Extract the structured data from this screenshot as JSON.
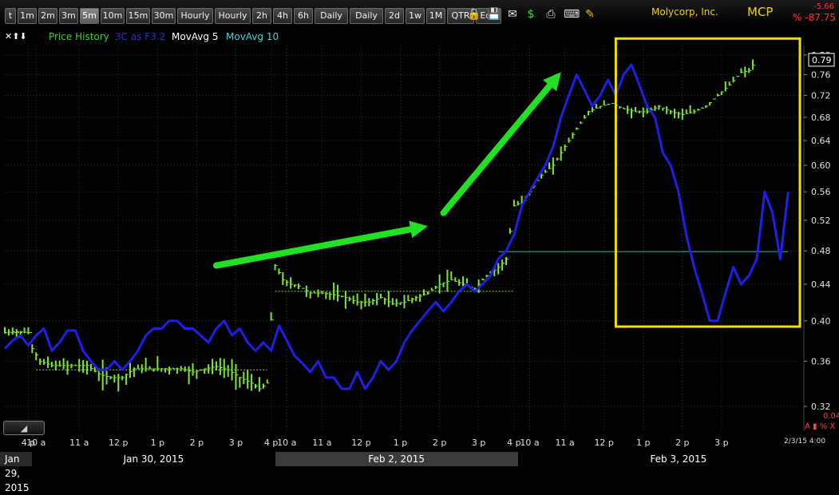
{
  "toolbar": {
    "timeframes": [
      "t",
      "1m",
      "2m",
      "3m",
      "5m",
      "10m",
      "15m",
      "30m",
      "Hourly",
      "Hourly",
      "2h",
      "4h",
      "6h",
      "Daily",
      "Daily",
      "2d",
      "1w",
      "1M",
      "QTR",
      "Edit"
    ],
    "active": "5m",
    "icons": [
      "lock-icon",
      "save-icon",
      "mail-icon",
      "dollar-icon",
      "print-icon",
      "keyboard-icon",
      "pencil-icon"
    ]
  },
  "header": {
    "company": "Molycorp, Inc.",
    "symbol": "MCP",
    "change": "-5.66",
    "change_pct": "% -87.75"
  },
  "legend": {
    "arrows": "✕⬆⬇",
    "items": [
      {
        "label": "Price History",
        "color": "#39d33a"
      },
      {
        "label": "3C as F3.2",
        "color": "#2b2bd9"
      },
      {
        "label": "MovAvg 5",
        "color": "#ffffff"
      },
      {
        "label": "MovAvg 10",
        "color": "#4ad3d3"
      }
    ]
  },
  "colors": {
    "price": "#7ee830",
    "indicator": "#1f1fe8",
    "arrow": "#22e022",
    "box": "#f0e000",
    "ref_line": "#3aa6a6",
    "grid": "#2a3a2a"
  },
  "chart_data": {
    "type": "line",
    "price_scale": {
      "ylim": [
        0.3,
        0.82
      ],
      "ticks": [
        "0.80",
        "0.76",
        "0.72",
        "0.68",
        "0.64",
        "0.60",
        "0.56",
        "0.52",
        "0.48",
        "0.44",
        "0.40",
        "0.36",
        "0.32"
      ],
      "last_value": "0.79"
    },
    "x_tick_labels": [
      "4 p",
      "10 a",
      "11 a",
      "12 p",
      "1 p",
      "2 p",
      "3 p",
      "4 p",
      "10 a",
      "11 a",
      "12 p",
      "1 p",
      "2 p",
      "3 p",
      "4 p",
      "10 a",
      "11 a",
      "12 p",
      "1 p",
      "2 p",
      "3 p"
    ],
    "x_tick_times": [
      6,
      8,
      19,
      29,
      39,
      49,
      59,
      68,
      72,
      81,
      91,
      101,
      111,
      121,
      130,
      134,
      143,
      153,
      163,
      173,
      183
    ],
    "date_labels": [
      "Jan 29, 2015",
      "Jan 30, 2015",
      "Feb 2, 2015",
      "Feb 3, 2015"
    ],
    "session_breaks": [
      7,
      69,
      131
    ],
    "series": [
      {
        "name": "Price History",
        "style": "ohlc-bars",
        "points": [
          [
            0,
            0.388
          ],
          [
            3,
            0.389
          ],
          [
            6,
            0.388
          ],
          [
            7,
            0.372
          ],
          [
            9,
            0.36
          ],
          [
            12,
            0.356
          ],
          [
            15,
            0.356
          ],
          [
            18,
            0.356
          ],
          [
            21,
            0.356
          ],
          [
            24,
            0.348
          ],
          [
            27,
            0.345
          ],
          [
            30,
            0.345
          ],
          [
            33,
            0.353
          ],
          [
            36,
            0.353
          ],
          [
            39,
            0.353
          ],
          [
            42,
            0.353
          ],
          [
            45,
            0.353
          ],
          [
            48,
            0.35
          ],
          [
            51,
            0.353
          ],
          [
            54,
            0.355
          ],
          [
            57,
            0.352
          ],
          [
            60,
            0.345
          ],
          [
            63,
            0.34
          ],
          [
            65,
            0.335
          ],
          [
            67,
            0.34
          ],
          [
            69,
            0.462
          ],
          [
            71,
            0.445
          ],
          [
            73,
            0.44
          ],
          [
            75,
            0.438
          ],
          [
            78,
            0.43
          ],
          [
            81,
            0.43
          ],
          [
            84,
            0.428
          ],
          [
            87,
            0.425
          ],
          [
            90,
            0.42
          ],
          [
            93,
            0.42
          ],
          [
            96,
            0.425
          ],
          [
            99,
            0.418
          ],
          [
            102,
            0.42
          ],
          [
            105,
            0.425
          ],
          [
            108,
            0.43
          ],
          [
            111,
            0.44
          ],
          [
            114,
            0.445
          ],
          [
            117,
            0.44
          ],
          [
            120,
            0.435
          ],
          [
            123,
            0.45
          ],
          [
            126,
            0.46
          ],
          [
            128,
            0.47
          ],
          [
            130,
            0.54
          ],
          [
            132,
            0.545
          ],
          [
            134,
            0.56
          ],
          [
            137,
            0.585
          ],
          [
            140,
            0.6
          ],
          [
            143,
            0.63
          ],
          [
            146,
            0.66
          ],
          [
            149,
            0.69
          ],
          [
            152,
            0.7
          ],
          [
            155,
            0.705
          ],
          [
            158,
            0.695
          ],
          [
            161,
            0.69
          ],
          [
            164,
            0.69
          ],
          [
            167,
            0.7
          ],
          [
            170,
            0.69
          ],
          [
            173,
            0.685
          ],
          [
            176,
            0.69
          ],
          [
            179,
            0.7
          ],
          [
            182,
            0.72
          ],
          [
            185,
            0.74
          ],
          [
            188,
            0.765
          ],
          [
            190,
            0.768
          ],
          [
            192,
            0.79
          ]
        ]
      },
      {
        "name": "3C as F3.2",
        "style": "line",
        "points": [
          [
            0,
            0.372
          ],
          [
            2,
            0.38
          ],
          [
            4,
            0.385
          ],
          [
            6,
            0.375
          ],
          [
            8,
            0.385
          ],
          [
            10,
            0.392
          ],
          [
            12,
            0.37
          ],
          [
            14,
            0.378
          ],
          [
            16,
            0.39
          ],
          [
            18,
            0.39
          ],
          [
            20,
            0.37
          ],
          [
            22,
            0.36
          ],
          [
            24,
            0.352
          ],
          [
            26,
            0.352
          ],
          [
            28,
            0.36
          ],
          [
            30,
            0.352
          ],
          [
            32,
            0.36
          ],
          [
            34,
            0.37
          ],
          [
            36,
            0.385
          ],
          [
            38,
            0.392
          ],
          [
            40,
            0.392
          ],
          [
            42,
            0.4
          ],
          [
            44,
            0.4
          ],
          [
            46,
            0.392
          ],
          [
            48,
            0.392
          ],
          [
            50,
            0.385
          ],
          [
            52,
            0.378
          ],
          [
            54,
            0.392
          ],
          [
            56,
            0.4
          ],
          [
            58,
            0.385
          ],
          [
            60,
            0.392
          ],
          [
            62,
            0.378
          ],
          [
            64,
            0.37
          ],
          [
            66,
            0.378
          ],
          [
            68,
            0.37
          ],
          [
            70,
            0.395
          ],
          [
            72,
            0.38
          ],
          [
            74,
            0.365
          ],
          [
            76,
            0.358
          ],
          [
            78,
            0.35
          ],
          [
            80,
            0.36
          ],
          [
            82,
            0.345
          ],
          [
            84,
            0.345
          ],
          [
            86,
            0.335
          ],
          [
            88,
            0.335
          ],
          [
            90,
            0.35
          ],
          [
            92,
            0.335
          ],
          [
            94,
            0.345
          ],
          [
            96,
            0.36
          ],
          [
            98,
            0.352
          ],
          [
            100,
            0.36
          ],
          [
            102,
            0.378
          ],
          [
            104,
            0.39
          ],
          [
            106,
            0.4
          ],
          [
            108,
            0.41
          ],
          [
            110,
            0.42
          ],
          [
            112,
            0.41
          ],
          [
            114,
            0.42
          ],
          [
            116,
            0.432
          ],
          [
            118,
            0.44
          ],
          [
            120,
            0.432
          ],
          [
            122,
            0.44
          ],
          [
            124,
            0.45
          ],
          [
            126,
            0.47
          ],
          [
            128,
            0.48
          ],
          [
            130,
            0.5
          ],
          [
            132,
            0.54
          ],
          [
            134,
            0.56
          ],
          [
            136,
            0.58
          ],
          [
            138,
            0.6
          ],
          [
            140,
            0.63
          ],
          [
            142,
            0.68
          ],
          [
            144,
            0.72
          ],
          [
            146,
            0.76
          ],
          [
            148,
            0.73
          ],
          [
            150,
            0.7
          ],
          [
            152,
            0.72
          ],
          [
            154,
            0.75
          ],
          [
            156,
            0.72
          ],
          [
            158,
            0.76
          ],
          [
            160,
            0.78
          ],
          [
            162,
            0.74
          ],
          [
            164,
            0.7
          ],
          [
            166,
            0.68
          ],
          [
            168,
            0.62
          ],
          [
            170,
            0.6
          ],
          [
            172,
            0.56
          ],
          [
            174,
            0.5
          ],
          [
            176,
            0.46
          ],
          [
            178,
            0.43
          ],
          [
            180,
            0.4
          ],
          [
            182,
            0.4
          ],
          [
            184,
            0.43
          ],
          [
            186,
            0.46
          ],
          [
            188,
            0.44
          ],
          [
            190,
            0.45
          ],
          [
            192,
            0.47
          ],
          [
            194,
            0.56
          ],
          [
            196,
            0.53
          ],
          [
            198,
            0.47
          ],
          [
            200,
            0.56
          ]
        ]
      }
    ],
    "reference_line": 0.479,
    "annotations": [
      {
        "type": "arrow",
        "from": [
          54,
          0.462
        ],
        "to": [
          108,
          0.512
        ]
      },
      {
        "type": "arrow",
        "from": [
          112,
          0.53
        ],
        "to": [
          142,
          0.765
        ]
      },
      {
        "type": "box",
        "x": [
          156,
          203
        ],
        "y": [
          0.394,
          0.835
        ]
      }
    ]
  },
  "footer": {
    "corner_date": "2/3/15 4:00",
    "corner_value": "0.04",
    "corner_controls": "A ▮ % X"
  }
}
